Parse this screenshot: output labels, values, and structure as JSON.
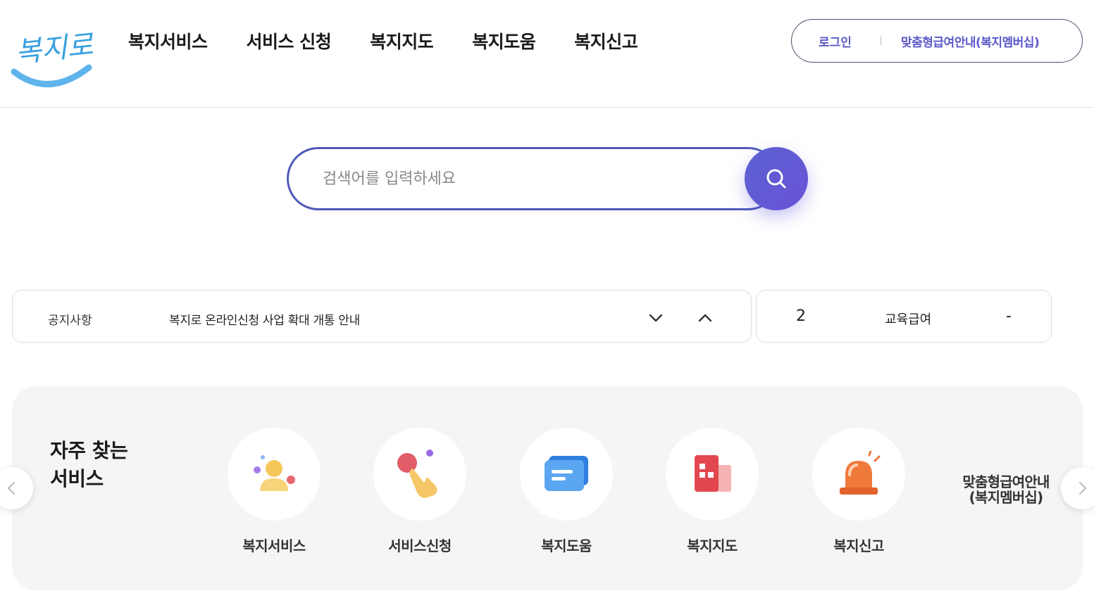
{
  "header": {
    "logo_text": "복지로",
    "nav": [
      {
        "label": "복지서비스"
      },
      {
        "label": "서비스 신청"
      },
      {
        "label": "복지지도"
      },
      {
        "label": "복지도움"
      },
      {
        "label": "복지신고"
      }
    ],
    "auth": {
      "login": "로그인",
      "membership": "맞춤형급여안내(복지멤버십)"
    }
  },
  "search": {
    "placeholder": "검색어를 입력하세요",
    "button_icon": "search-icon"
  },
  "notice": {
    "label": "공지사항",
    "text": "복지로 온라인신청 사업 확대 개통 안내",
    "down_icon": "chevron-down-icon",
    "up_icon": "chevron-up-icon"
  },
  "ranking": {
    "rank": "2",
    "keyword": "교육급여",
    "change": "-"
  },
  "frequent": {
    "title_line1": "자주 찾는",
    "title_line2": "서비스",
    "services": [
      {
        "label": "복지서비스",
        "icon": "person-icon"
      },
      {
        "label": "서비스신청",
        "icon": "hand-pointer-icon"
      },
      {
        "label": "복지도움",
        "icon": "chat-bubble-icon"
      },
      {
        "label": "복지지도",
        "icon": "building-icon"
      },
      {
        "label": "복지신고",
        "icon": "siren-icon"
      }
    ],
    "member_line1": "맞춤형급여안내",
    "member_line2": "(복지멤버십)",
    "prev_icon": "chevron-left-icon",
    "next_icon": "chevron-right-icon"
  },
  "colors": {
    "accent": "#5c59c8",
    "search_border": "#5059b8",
    "panel_bg": "#f5f5f5"
  }
}
